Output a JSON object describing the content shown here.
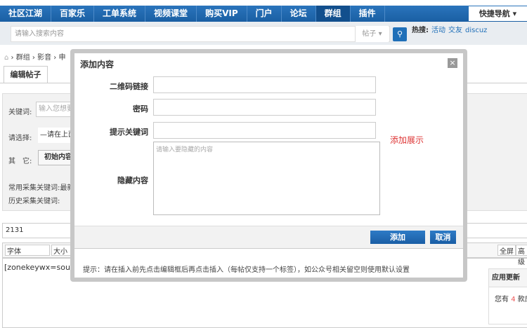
{
  "nav": {
    "items": [
      "社区江湖",
      "百家乐",
      "工单系统",
      "视频课堂",
      "购买VIP",
      "门户",
      "论坛",
      "群组",
      "插件"
    ],
    "active": "群组",
    "quick_nav": "快捷导航 ▾"
  },
  "search": {
    "placeholder": "请输入搜索内容",
    "type": "帖子 ▾",
    "hot_label": "热搜:",
    "hot": [
      "活动",
      "交友",
      "discuz"
    ]
  },
  "breadcrumb": [
    "群组",
    "影音",
    "申"
  ],
  "tab": "编辑帖子",
  "panel": {
    "keyword_label": "关键词:",
    "keyword_placeholder": "输入您想要采",
    "select_label": "请选择:",
    "select_value": "—请在上面",
    "other_label": "其　它:",
    "init_button": "初始内容",
    "common_label": "常用采集关键词:最新",
    "history_label": "历史采集关键词:"
  },
  "post_title": "2131",
  "editor": {
    "font": "字体",
    "size": "大小",
    "content": "[zonekeywx=source",
    "fullscreen": "全屏",
    "advanced": "高级"
  },
  "sidebar": {
    "title": "应用更新",
    "text_prefix": "您有",
    "count": "4",
    "text_suffix": "款应"
  },
  "modal": {
    "title": "添加内容",
    "close": "×",
    "qr_label": "二维码链接",
    "password_label": "密码",
    "hint_label": "提示关键词",
    "hidden_label": "隐藏内容",
    "hidden_placeholder": "请输入要隐藏的内容",
    "add_display": "添加展示",
    "add_button": "添加",
    "cancel_button": "取消",
    "tip": "提示：请在插入前先点击编辑框后再点击插入（每帖仅支持一个标签），如公众号相关留空则使用默认设置"
  }
}
